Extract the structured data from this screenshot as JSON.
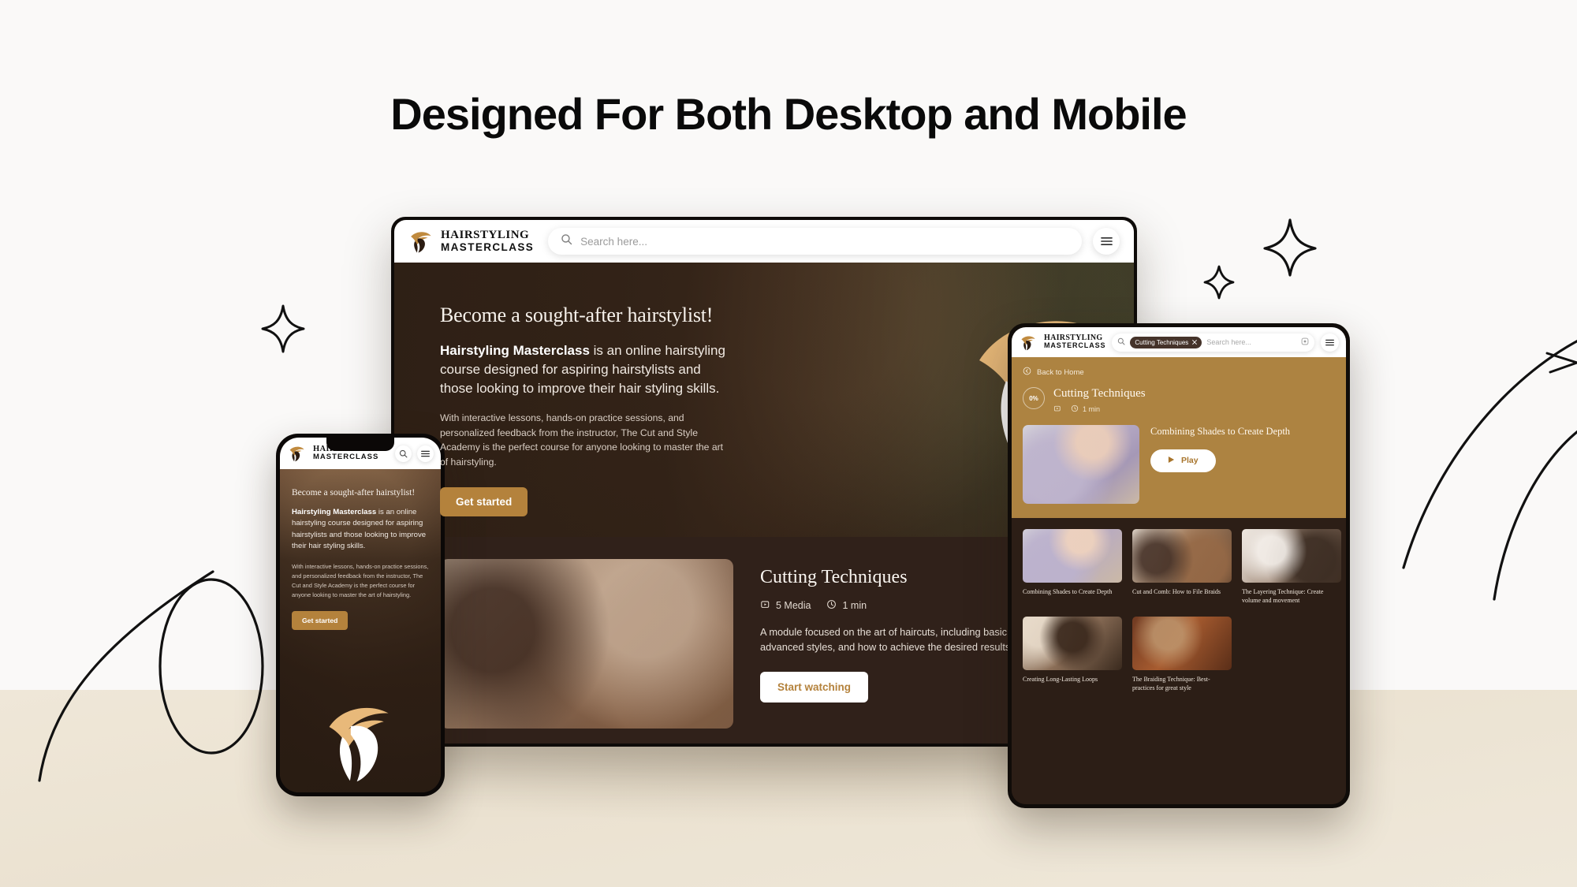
{
  "page": {
    "title": "Designed For Both Desktop and Mobile",
    "accent_gold": "#B4823C",
    "tablet_gold": "#AD8341",
    "dark_brown": "#2C1E16",
    "cream_band": "#EFE7D8"
  },
  "brand": {
    "line1": "HAIRSTYLING",
    "line2": "MASTERCLASS"
  },
  "desktop": {
    "search": {
      "placeholder": "Search here..."
    },
    "hero": {
      "heading": "Become a sought-after hairstylist!",
      "lead_strong": "Hairstyling Masterclass",
      "lead_rest": " is an online hairstyling course designed for aspiring hairstylists and those looking to improve their hair styling skills.",
      "sub": "With interactive lessons, hands-on practice sessions, and personalized feedback from the instructor, The Cut and Style Academy is the perfect course for anyone looking to master the art of hairstyling.",
      "cta": "Get started"
    },
    "module": {
      "heading": "Cutting Techniques",
      "media_count": "5 Media",
      "duration": "1 min",
      "description": "A module focused on the art of haircuts, including basic cuts, advanced styles, and how to achieve the desired results.",
      "cta": "Start watching"
    }
  },
  "tablet": {
    "search": {
      "chip": "Cutting Techniques",
      "placeholder": "Search here..."
    },
    "back_label": "Back to Home",
    "progress": "0%",
    "module_title": "Cutting Techniques",
    "duration": "1 min",
    "feature": {
      "title": "Combining Shades to Create Depth",
      "play_label": "Play"
    },
    "lessons": [
      {
        "caption": "Combining Shades to Create Depth",
        "thumb": "thumb-a"
      },
      {
        "caption": "Cut and Comb: How to File Braids",
        "thumb": "thumb-b"
      },
      {
        "caption": "The Layering Technique: Create volume and movement",
        "thumb": "thumb-c"
      },
      {
        "caption": "Creating Long-Lasting Loops",
        "thumb": "thumb-d"
      },
      {
        "caption": "The Braiding Technique: Best-practices for great style",
        "thumb": "thumb-e"
      }
    ]
  },
  "mobile": {
    "hero": {
      "heading": "Become a sought-after hairstylist!",
      "lead_strong": "Hairstyling Masterclass",
      "lead_rest": " is an online hairstyling course designed for aspiring hairstylists and those looking to improve their hair styling skills.",
      "sub": "With interactive lessons, hands-on practice sessions, and personalized feedback from the instructor, The Cut and Style Academy is the perfect course for anyone looking to master the art of hairstyling.",
      "cta": "Get started"
    }
  }
}
